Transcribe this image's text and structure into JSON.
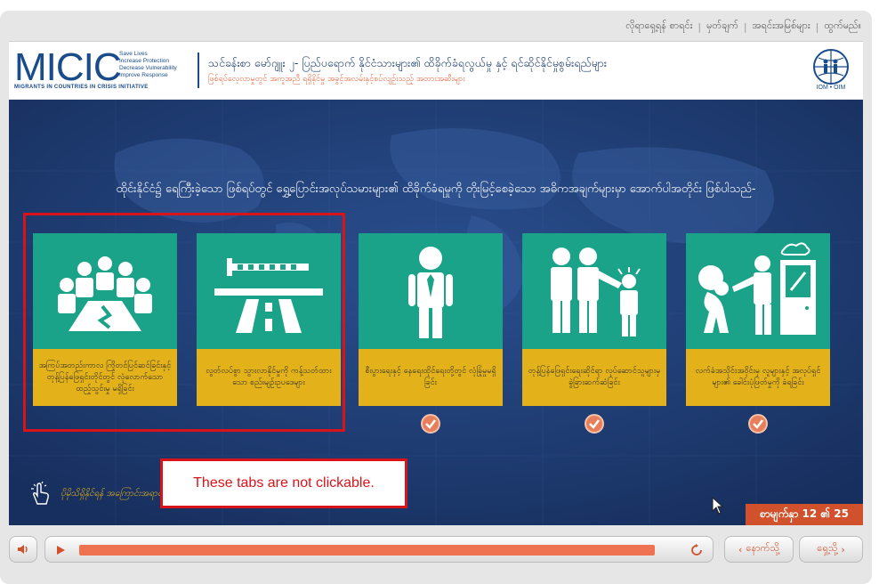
{
  "topnav": {
    "items": [
      "လိုရာရှေ့ရန် စာရင်း",
      "မှတ်ချက်",
      "အရင်းအမြစ်များ",
      "ထွက်မည်။"
    ]
  },
  "header": {
    "logo_big": "MICIC",
    "logo_small": [
      "Save Lives",
      "Increase Protection",
      "Decrease Vulnerability",
      "Improve Response"
    ],
    "logo_tag": "MIGRANTS IN COUNTRIES IN CRISIS INITIATIVE",
    "title": "သင်ခန်းစာ မော်ဂျူး ၂- ပြည်ပရောက် နိုင်ငံသားများ၏ ထိခိုက်ခံရလွယ်မှု နှင့် ရင်ဆိုင်နိုင်မှုစွမ်းရည်များ",
    "subtitle": "ဖြစ်ရပ်လေ့လာမှုတွင် အကူအညီ ရရှိနိုင်မှု အခွင့်အလမ်းနှင့်စပ်လျဉ်းသည့် အတားအဆီးများ",
    "iom_label": "IOM • OIM"
  },
  "stage": {
    "intro": "ထိုင်းနိုင်ငံ၌ ရေကြီးခဲ့သော ဖြစ်ရပ်တွင် ရွှေ့ပြောင်းအလုပ်သမားများ၏ ထိခိုက်ခံရမှုကို တိုးမြင့်စေခဲ့သော အဓိကအချက်များမှာ အောက်ပါအတိုင်း ဖြစ်ပါသည်-",
    "cards": [
      {
        "label": "အကြပ်အတည်းကာလ ကြိုတင်ပြင်ဆင်ခြင်းနှင့် တုန့်ပြန်ဖြေရှင်းတိုင်တွင် လုံလောက်သော ထည့်သွင်းမှု မရှိခြင်း",
        "icon": "meeting-icon",
        "checked": false
      },
      {
        "label": "လွတ်လပ်စွာ သွားလာနိုင်မှုကို ကန့်သတ်ထားသော စည်းမျဉ်းဥပဒေများ",
        "icon": "roadblock-icon",
        "checked": false
      },
      {
        "label": "စီးပွားရေးနှင့် နေရေးထိုင်ရေးတို့တွင် လုံခြုံမှုမရှိခြင်း",
        "icon": "worker-icon",
        "checked": true
      },
      {
        "label": "တုန့်ပြန်ဖြေရှင်းရေးဆိုင်ရာ လုပ်ဆောင်သူများမှ ခွဲခြားဆက်ဆံခြင်း",
        "icon": "discrimination-icon",
        "checked": true
      },
      {
        "label": "လက်ခံအသိုင်းအဝိုင်းမှ လူများနှင့် အလုပ်ရှင်များ၏ ခေါင်းပုံဖြတ်မှုကို ခံရခြင်း",
        "icon": "exploitation-icon",
        "checked": true
      }
    ],
    "callout": "These tabs are not clickable.",
    "hint": "ပိုမိုသိရှိနိုင်ရန် အကြောင်းအရာတစ်ခုချင်းကို နှိပ်ပါ",
    "page_count": "စာမျက်နှာ 12 ၏ 25"
  },
  "controls": {
    "progress": 0.96,
    "back_label": "နောက်သို့",
    "next_label": "ရှေ့သို့"
  },
  "colors": {
    "navy": "#1e3b73",
    "teal": "#1aa388",
    "gold": "#e3b21a",
    "accent": "#d1512c",
    "callout_red": "#d8141a"
  }
}
